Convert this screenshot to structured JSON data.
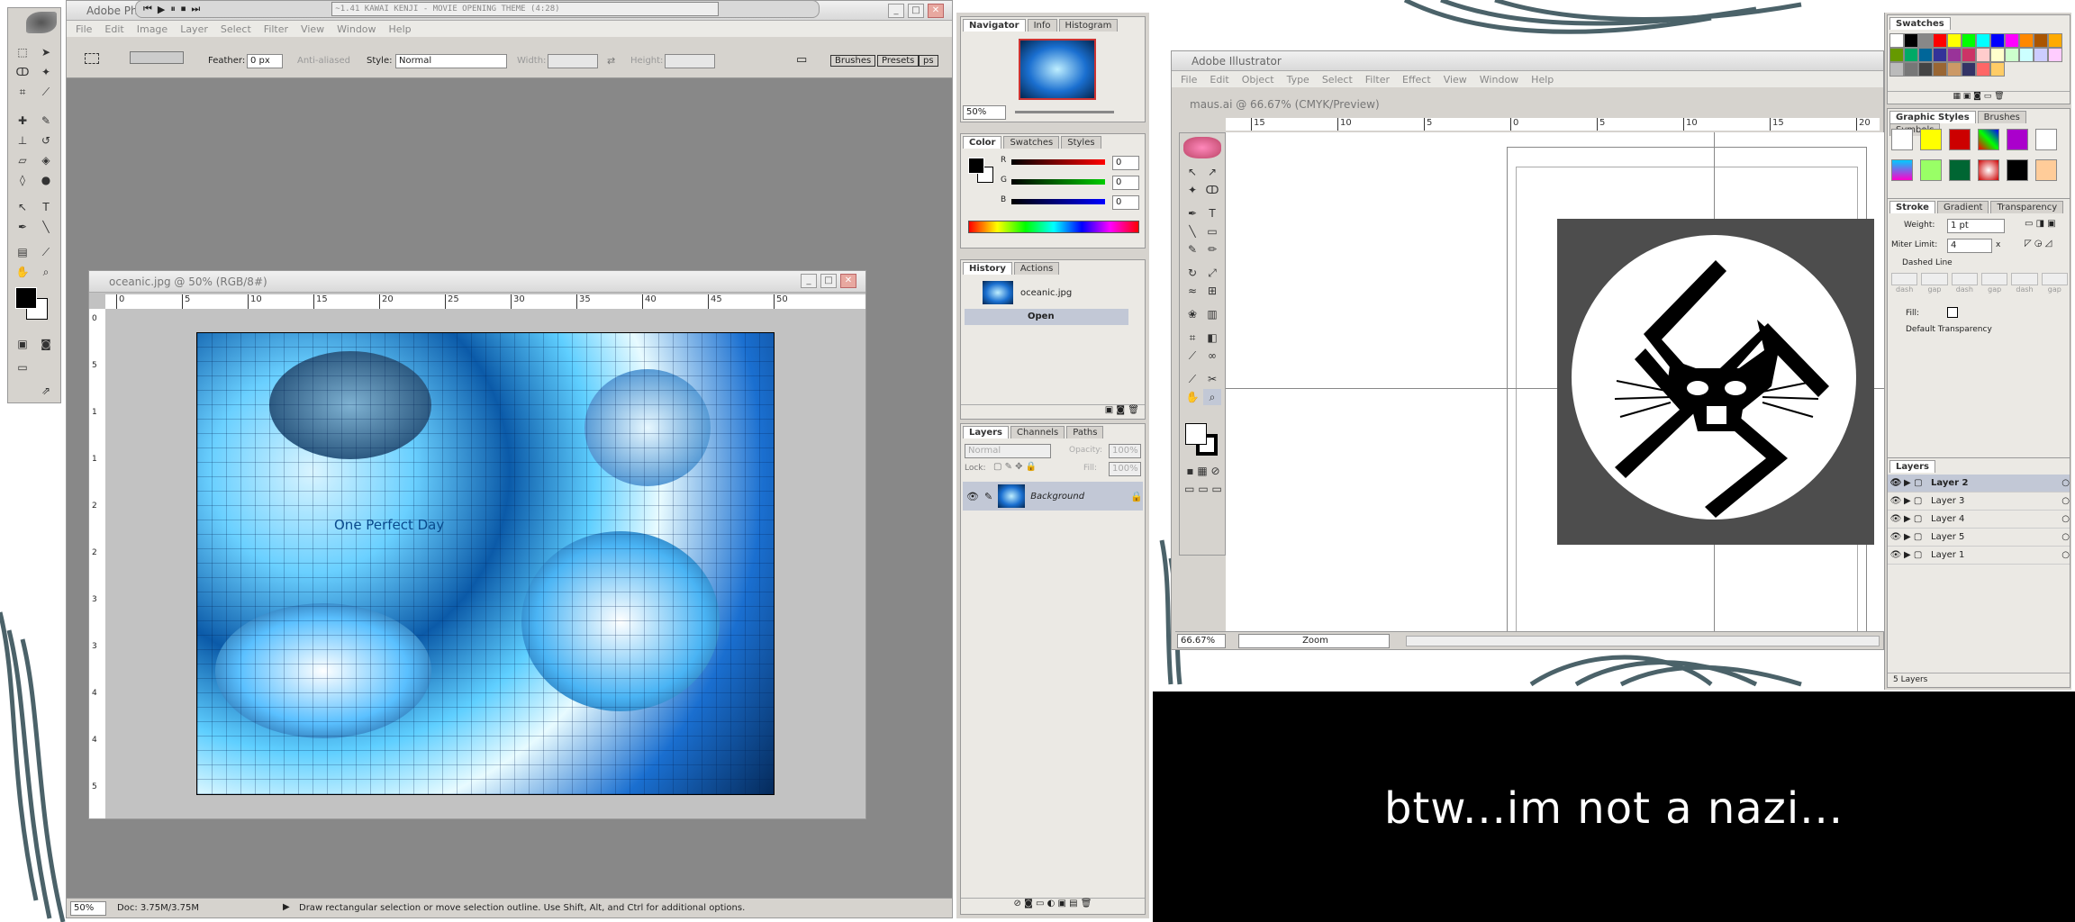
{
  "media": {
    "track": "~1.41  KAWAI KENJI - MOVIE OPENING THEME (4:28)"
  },
  "photoshop": {
    "title": "Adobe Photoshop",
    "menu": [
      "File",
      "Edit",
      "Image",
      "Layer",
      "Select",
      "Filter",
      "View",
      "Window",
      "Help"
    ],
    "options": {
      "feather_label": "Feather:",
      "feather_value": "0 px",
      "antialiased": "Anti-aliased",
      "style_label": "Style:",
      "style_value": "Normal",
      "width_label": "Width:",
      "height_label": "Height:",
      "brushes_tab": "Brushes",
      "presets_tab": "Presets",
      "presets_tab2": "ps"
    },
    "doc": {
      "title": "oceanic.jpg @ 50% (RGB/8#)",
      "canvas_text": "One Perfect Day",
      "ruler_ticks": [
        "0",
        "5",
        "10",
        "15",
        "20",
        "25",
        "30",
        "35",
        "40",
        "45",
        "50"
      ],
      "vruler_ticks": [
        "0",
        "5",
        "1",
        "1",
        "2",
        "2",
        "3",
        "3",
        "4",
        "4",
        "5"
      ]
    },
    "status": {
      "zoom": "50%",
      "doc": "Doc: 3.75M/3.75M",
      "hint": "Draw rectangular selection or move selection outline.  Use Shift, Alt, and Ctrl for additional options."
    }
  },
  "ps_panels": {
    "navigator": {
      "tabs": [
        "Navigator",
        "Info",
        "Histogram"
      ],
      "zoom": "50%"
    },
    "color": {
      "tabs": [
        "Color",
        "Swatches",
        "Styles"
      ],
      "r": "0",
      "g": "0",
      "b": "0",
      "r_label": "R",
      "g_label": "G",
      "b_label": "B"
    },
    "history": {
      "tabs": [
        "History",
        "Actions"
      ],
      "file": "oceanic.jpg",
      "open": "Open"
    },
    "layers": {
      "tabs": [
        "Layers",
        "Channels",
        "Paths"
      ],
      "mode": "Normal",
      "opacity_label": "Opacity:",
      "opacity": "100%",
      "lock_label": "Lock:",
      "fill_label": "Fill:",
      "fill": "100%",
      "layer": "Background"
    }
  },
  "illustrator": {
    "title": "Adobe Illustrator",
    "menu": [
      "File",
      "Edit",
      "Object",
      "Type",
      "Select",
      "Filter",
      "Effect",
      "View",
      "Window",
      "Help"
    ],
    "doc_title": "maus.ai @ 66.67% (CMYK/Preview)",
    "ruler_ticks": [
      "15",
      "10",
      "5",
      "0",
      "5",
      "10",
      "15",
      "20"
    ],
    "zoom": "66.67%",
    "status_mode": "Zoom"
  },
  "ai_panels": {
    "swatches": {
      "title": "Swatches"
    },
    "graphic_styles": {
      "tabs": [
        "Graphic Styles",
        "Brushes",
        "Symbols"
      ]
    },
    "stroke": {
      "tabs": [
        "Stroke",
        "Gradient",
        "Transparency"
      ],
      "weight_label": "Weight:",
      "weight": "1 pt",
      "miter_label": "Miter Limit:",
      "miter": "4",
      "miter_unit": "x",
      "dashed": "Dashed Line",
      "dash_labels": [
        "dash",
        "gap",
        "dash",
        "gap",
        "dash",
        "gap"
      ],
      "fill_label": "Fill:",
      "transparency": "Default Transparency"
    },
    "layers": {
      "title": "Layers",
      "items": [
        "Layer 2",
        "Layer 3",
        "Layer 4",
        "Layer 5",
        "Layer 1"
      ],
      "count": "5 Layers"
    }
  },
  "caption": "btw...im not a nazi..."
}
